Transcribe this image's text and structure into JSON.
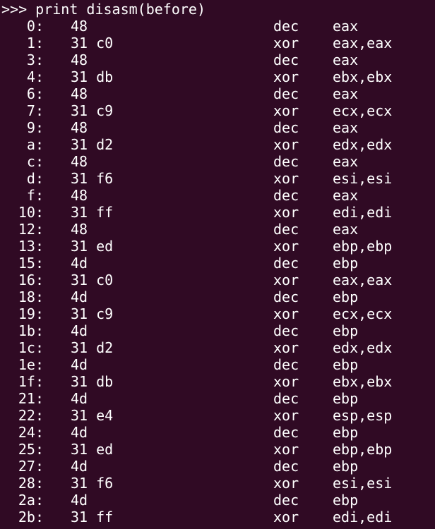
{
  "terminal": {
    "prompt": ">>> print disasm(before)",
    "rows": [
      {
        "addr": "0:",
        "bytes": "48",
        "mnemonic": "dec",
        "operands": "eax"
      },
      {
        "addr": "1:",
        "bytes": "31 c0",
        "mnemonic": "xor",
        "operands": "eax,eax"
      },
      {
        "addr": "3:",
        "bytes": "48",
        "mnemonic": "dec",
        "operands": "eax"
      },
      {
        "addr": "4:",
        "bytes": "31 db",
        "mnemonic": "xor",
        "operands": "ebx,ebx"
      },
      {
        "addr": "6:",
        "bytes": "48",
        "mnemonic": "dec",
        "operands": "eax"
      },
      {
        "addr": "7:",
        "bytes": "31 c9",
        "mnemonic": "xor",
        "operands": "ecx,ecx"
      },
      {
        "addr": "9:",
        "bytes": "48",
        "mnemonic": "dec",
        "operands": "eax"
      },
      {
        "addr": "a:",
        "bytes": "31 d2",
        "mnemonic": "xor",
        "operands": "edx,edx"
      },
      {
        "addr": "c:",
        "bytes": "48",
        "mnemonic": "dec",
        "operands": "eax"
      },
      {
        "addr": "d:",
        "bytes": "31 f6",
        "mnemonic": "xor",
        "operands": "esi,esi"
      },
      {
        "addr": "f:",
        "bytes": "48",
        "mnemonic": "dec",
        "operands": "eax"
      },
      {
        "addr": "10:",
        "bytes": "31 ff",
        "mnemonic": "xor",
        "operands": "edi,edi"
      },
      {
        "addr": "12:",
        "bytes": "48",
        "mnemonic": "dec",
        "operands": "eax"
      },
      {
        "addr": "13:",
        "bytes": "31 ed",
        "mnemonic": "xor",
        "operands": "ebp,ebp"
      },
      {
        "addr": "15:",
        "bytes": "4d",
        "mnemonic": "dec",
        "operands": "ebp"
      },
      {
        "addr": "16:",
        "bytes": "31 c0",
        "mnemonic": "xor",
        "operands": "eax,eax"
      },
      {
        "addr": "18:",
        "bytes": "4d",
        "mnemonic": "dec",
        "operands": "ebp"
      },
      {
        "addr": "19:",
        "bytes": "31 c9",
        "mnemonic": "xor",
        "operands": "ecx,ecx"
      },
      {
        "addr": "1b:",
        "bytes": "4d",
        "mnemonic": "dec",
        "operands": "ebp"
      },
      {
        "addr": "1c:",
        "bytes": "31 d2",
        "mnemonic": "xor",
        "operands": "edx,edx"
      },
      {
        "addr": "1e:",
        "bytes": "4d",
        "mnemonic": "dec",
        "operands": "ebp"
      },
      {
        "addr": "1f:",
        "bytes": "31 db",
        "mnemonic": "xor",
        "operands": "ebx,ebx"
      },
      {
        "addr": "21:",
        "bytes": "4d",
        "mnemonic": "dec",
        "operands": "ebp"
      },
      {
        "addr": "22:",
        "bytes": "31 e4",
        "mnemonic": "xor",
        "operands": "esp,esp"
      },
      {
        "addr": "24:",
        "bytes": "4d",
        "mnemonic": "dec",
        "operands": "ebp"
      },
      {
        "addr": "25:",
        "bytes": "31 ed",
        "mnemonic": "xor",
        "operands": "ebp,ebp"
      },
      {
        "addr": "27:",
        "bytes": "4d",
        "mnemonic": "dec",
        "operands": "ebp"
      },
      {
        "addr": "28:",
        "bytes": "31 f6",
        "mnemonic": "xor",
        "operands": "esi,esi"
      },
      {
        "addr": "2a:",
        "bytes": "4d",
        "mnemonic": "dec",
        "operands": "ebp"
      },
      {
        "addr": "2b:",
        "bytes": "31 ff",
        "mnemonic": "xor",
        "operands": "edi,edi"
      }
    ]
  },
  "colors": {
    "background": "#300a24",
    "text": "#ffffff"
  }
}
